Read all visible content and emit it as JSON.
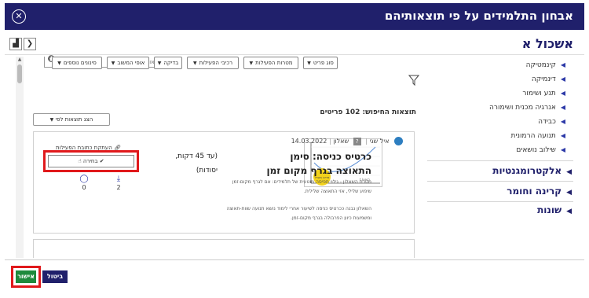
{
  "window": {
    "title": "אבחון התלמידים על פי תוצאותיהם",
    "close_icon": "close-icon"
  },
  "header": {
    "subtitle": "אשכול א"
  },
  "sidebar": {
    "items": [
      {
        "label": "קינמטיקה"
      },
      {
        "label": "דינמיקה"
      },
      {
        "label": "תנע ושימור"
      },
      {
        "label": "אנרגיה מכנית ושימורה"
      },
      {
        "label": "כבידה"
      },
      {
        "label": "תנועה הרמונית"
      },
      {
        "label": "שילוב נושאים"
      }
    ],
    "sections": [
      {
        "label": "אלקטרומגנטיות"
      },
      {
        "label": "קרינה וחומר"
      },
      {
        "label": "שונות"
      }
    ]
  },
  "search": {
    "placeholder": "שם, תיאור או יוצר"
  },
  "filters": [
    {
      "label": "סוג פריט"
    },
    {
      "label": "מטרות הפעילות"
    },
    {
      "label": "רכיבי הפעילות"
    },
    {
      "label": "בדיקה"
    },
    {
      "label": "אופי המשוב"
    },
    {
      "label": "סינונים נוספים"
    }
  ],
  "results": {
    "title": "תוצאות החיפוש: 102 פריטים",
    "sort_label": "הצג תוצאות לפי"
  },
  "card": {
    "author": "איל שגי",
    "type": "שאלון",
    "date": "14.03.2022",
    "title_line1": "כרטיס כניסה: סימן",
    "sub_line1": "(עד 45 דקות,",
    "title_line2": "התאוצה בגרף מקום זמן",
    "sub_line2": "יסודות)",
    "desc_line1": "מטרת השאלון - גילוי תפיסה מוטעית של תלמידים: אם לגרף מקום-זמן",
    "desc_line2": "שיפוע שלילי, אזי התאוצה שלילית.",
    "desc_line3": "השאלון נבנה ככרטיס כניסה לשיעור אחרי לימוד נושא תנועה שוות-תאוצה",
    "desc_line4": "ומשמעות כיוון הפרבולה בגרף מקום-זמן.",
    "copy_link": "העתקת כתובת הפעילות",
    "select_label": "בחירה",
    "downloads": "2",
    "comments": "0",
    "thumb_axis_label": "t (sec)",
    "thumb_badge": "פריט מוביל"
  },
  "footer": {
    "approve": "אישור",
    "cancel": "ביטול"
  },
  "colors": {
    "primary": "#20206b",
    "approve": "#1f8a3d",
    "highlight": "#e0191c"
  }
}
